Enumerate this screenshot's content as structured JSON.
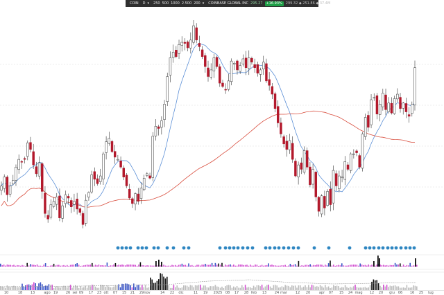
{
  "toolbar": {
    "chart_icon": "line-chart-icon",
    "symbol": "COIN",
    "interval": "D",
    "interval_arrow": "▾",
    "counts": [
      "250",
      "500",
      "1000",
      "2.500",
      "200"
    ],
    "counts_arrow": "▾",
    "company": "COINBASE GLOBAL INC",
    "price": "295.27",
    "change_pct": "+16.93%",
    "quote": "299.32 ◆ 251.86 ◆ 37.4M",
    "accent": "#1e9e46"
  },
  "chart_data": {
    "type": "candlestick",
    "symbol": "COIN",
    "x_labels": [
      "10",
      "18",
      "13",
      "ago",
      "19",
      "26",
      "sei",
      "09",
      "17",
      "23",
      "ott",
      "07",
      "15",
      "21",
      "29",
      "nov",
      "14",
      "22",
      "dic",
      "11",
      "19",
      "2025",
      "08",
      "17",
      "28",
      "feb",
      "13",
      "24",
      "mar",
      "12",
      "20",
      "apr",
      "07",
      "15",
      "24",
      "mag",
      "12",
      "20",
      "giu",
      "06",
      "16",
      "25",
      "lug"
    ],
    "prices": [
      188,
      196,
      180,
      188,
      193,
      205,
      212,
      210,
      212,
      227,
      221,
      207,
      199,
      209,
      183,
      163,
      158,
      171,
      174,
      178,
      159,
      170,
      180,
      177,
      169,
      174,
      167,
      164,
      153,
      175,
      182,
      198,
      194,
      190,
      197,
      217,
      228,
      231,
      219,
      214,
      212,
      205,
      196,
      188,
      177,
      172,
      181,
      174,
      186,
      195,
      199,
      195,
      233,
      242,
      240,
      247,
      262,
      287,
      304,
      309,
      305,
      316,
      318,
      317,
      313,
      320,
      333,
      320,
      314,
      305,
      296,
      287,
      293,
      304,
      296,
      281,
      278,
      275,
      283,
      301,
      299,
      293,
      297,
      303,
      295,
      304,
      300,
      295,
      290,
      293,
      300,
      283,
      279,
      271,
      258,
      245,
      235,
      226,
      221,
      229,
      212,
      197,
      207,
      203,
      220,
      205,
      189,
      203,
      178,
      165,
      179,
      168,
      183,
      171,
      202,
      188,
      197,
      196,
      210,
      203,
      217,
      217,
      218,
      205,
      235,
      250,
      241,
      266,
      268,
      253,
      262,
      272,
      257,
      263,
      254,
      267,
      271,
      258,
      263,
      255,
      251,
      262,
      295
    ],
    "colors": {
      "up": "#ffffff",
      "down": "#b2182b",
      "outline": "#333333",
      "ma_short": "#5b8fd6",
      "ma_long": "#d84a3a"
    },
    "grid": true,
    "indicator_colors": {
      "blue": "#3a55c6",
      "black": "#111111",
      "pink": "#d24ed0",
      "gray": "#bdbdbd",
      "dot": "#2e86c1"
    }
  }
}
